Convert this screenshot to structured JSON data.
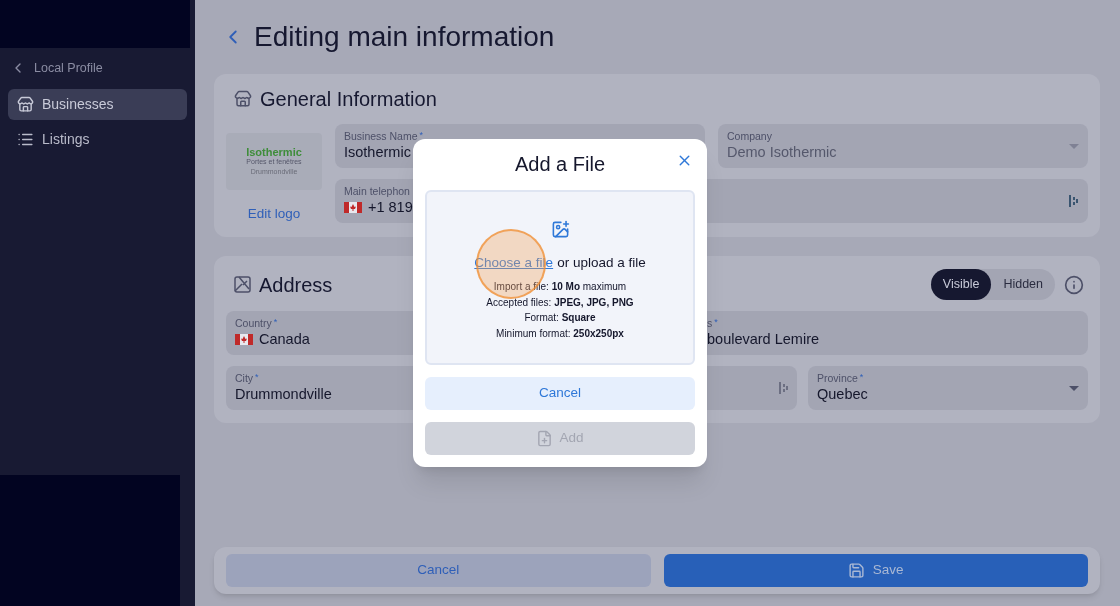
{
  "sidebar": {
    "back_label": "Local Profile",
    "items": [
      {
        "label": "Businesses",
        "selected": true
      },
      {
        "label": "Listings",
        "selected": false
      }
    ]
  },
  "page": {
    "title": "Editing main information"
  },
  "general": {
    "title": "General Information",
    "logo": {
      "name": "Isothermic",
      "tagline": "Portes et fenêtres",
      "city": "Drummondville"
    },
    "edit_logo": "Edit logo",
    "business_name": {
      "label": "Business Name",
      "mark": "*",
      "value": "Isothermic"
    },
    "company": {
      "label": "Company",
      "value": "Demo Isothermic",
      "disabled": true
    },
    "telephone": {
      "label": "Main telephon",
      "value": "+1 819"
    }
  },
  "address": {
    "title": "Address",
    "visibility": [
      {
        "label": "Visible",
        "selected": true
      },
      {
        "label": "Hidden",
        "selected": false
      }
    ],
    "country": {
      "label": "Country",
      "mark": "*",
      "value": "Canada"
    },
    "street": {
      "label": "s",
      "mark": "*",
      "value": "boulevard Lemire"
    },
    "city": {
      "label": "City",
      "mark": "*",
      "value": "Drummondville"
    },
    "province": {
      "label": "Province",
      "mark": "*",
      "value": "Quebec"
    }
  },
  "footer": {
    "cancel": "Cancel",
    "save": "Save"
  },
  "modal": {
    "title": "Add a File",
    "link": "Choose a file",
    "prompt": "or upload a file",
    "rules": [
      "Import a file: **10 Mo** maximum",
      "Accepted files: **JPEG, JPG, PNG**",
      "Format: **Square**",
      "Minimum format: **250x250px**"
    ],
    "cancel": "Cancel",
    "add": {
      "label": "Add",
      "disabled": true
    }
  }
}
